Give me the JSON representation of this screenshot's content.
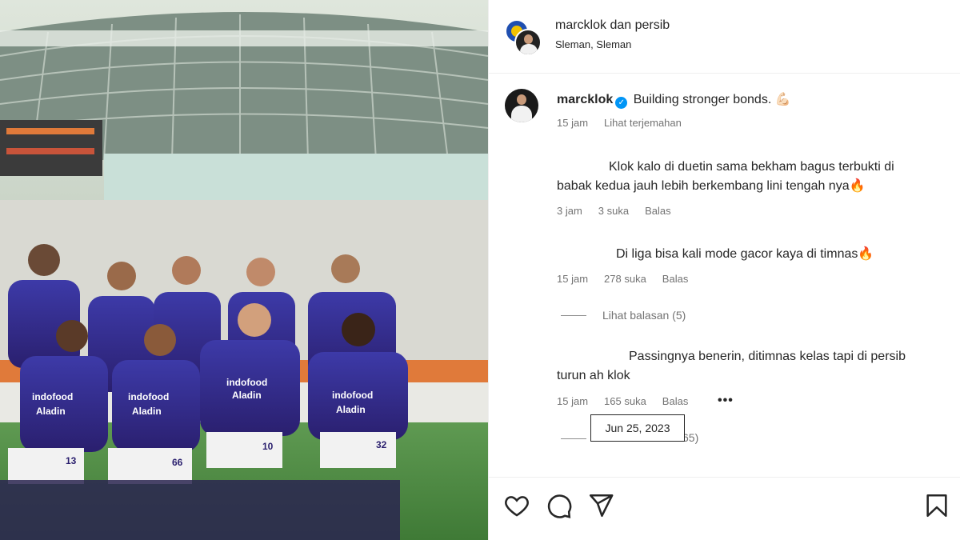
{
  "post": {
    "header": {
      "collab_user": "marcklok",
      "collab_joiner": "dan",
      "collab_partner": "persib",
      "location": "Sleman, Sleman"
    },
    "caption": {
      "username": "marcklok",
      "text": "Building stronger bonds. 💪🏻",
      "time": "15 jam",
      "translate": "Lihat terjemahan"
    },
    "comments": [
      {
        "text_line1": "Klok kalo di duetin sama bekham bagus terbukti di",
        "text_line2": "babak kedua jauh lebih berkembang lini tengah nya🔥",
        "time": "3 jam",
        "likes": "3 suka",
        "reply": "Balas"
      },
      {
        "text_line1": "Di liga bisa kali mode gacor kaya di timnas🔥",
        "time": "15 jam",
        "likes": "278 suka",
        "reply": "Balas",
        "view_replies": "Lihat balasan (5)"
      },
      {
        "text_line1": "Passingnya benerin, ditimnas kelas tapi di persib",
        "text_line2": "turun ah klok",
        "time": "15 jam",
        "likes": "165 suka",
        "reply": "Balas",
        "more": "•••",
        "view_replies_partial": "65)"
      }
    ],
    "tooltip": "Jun 25, 2023"
  },
  "icons": [
    "heart-icon",
    "comment-icon",
    "share-icon",
    "bookmark-icon",
    "verified-icon"
  ],
  "colors": {
    "verified": "#0095f6",
    "meta_text": "#737373",
    "jersey": "#3b2d8c"
  }
}
